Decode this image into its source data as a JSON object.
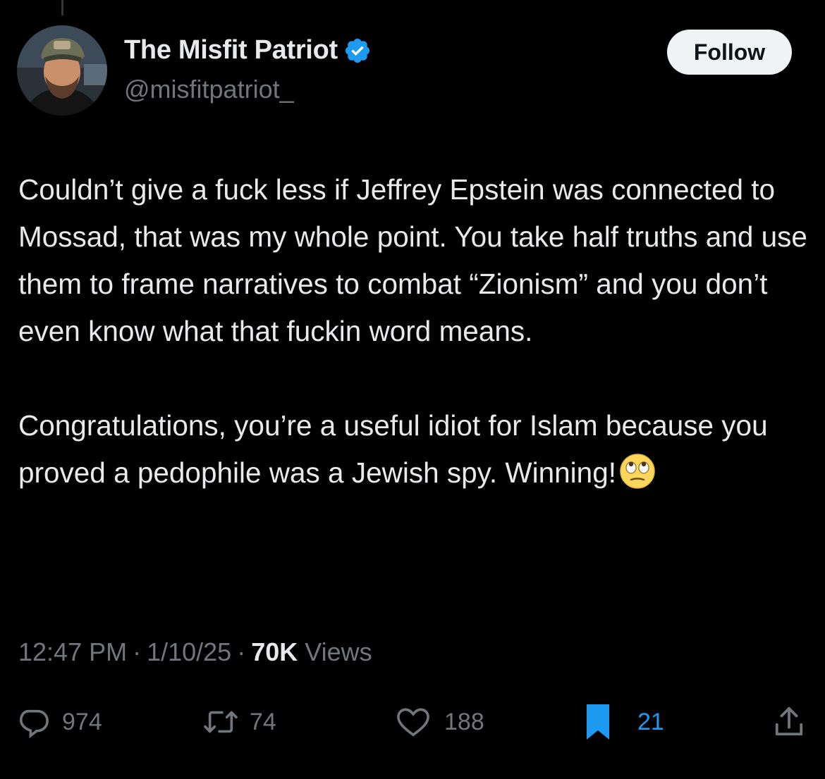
{
  "author": {
    "display_name": "The Misfit Patriot",
    "handle": "@misfitpatriot_",
    "verified": true,
    "verified_color": "#1d9bf0"
  },
  "follow_button": {
    "label": "Follow"
  },
  "tweet": {
    "paragraphs": [
      "Couldn’t give a fuck less if Jeffrey Epstein was connected to Mossad, that was my whole point. You take half truths and use them to frame narratives to combat “Zionism” and you don’t even know what that fuckin word means.",
      "Congratulations, you’re a useful idiot for Islam because you proved a pedophile was a Jewish spy. Winning!"
    ],
    "emoji": "face-with-rolling-eyes-icon"
  },
  "meta": {
    "time": "12:47 PM",
    "separator": "·",
    "date": "1/10/25",
    "views_count": "70K",
    "views_label": "Views"
  },
  "actions": {
    "replies": "974",
    "reposts": "74",
    "likes": "188",
    "bookmarks": "21",
    "bookmark_active_color": "#1d9bf0"
  }
}
